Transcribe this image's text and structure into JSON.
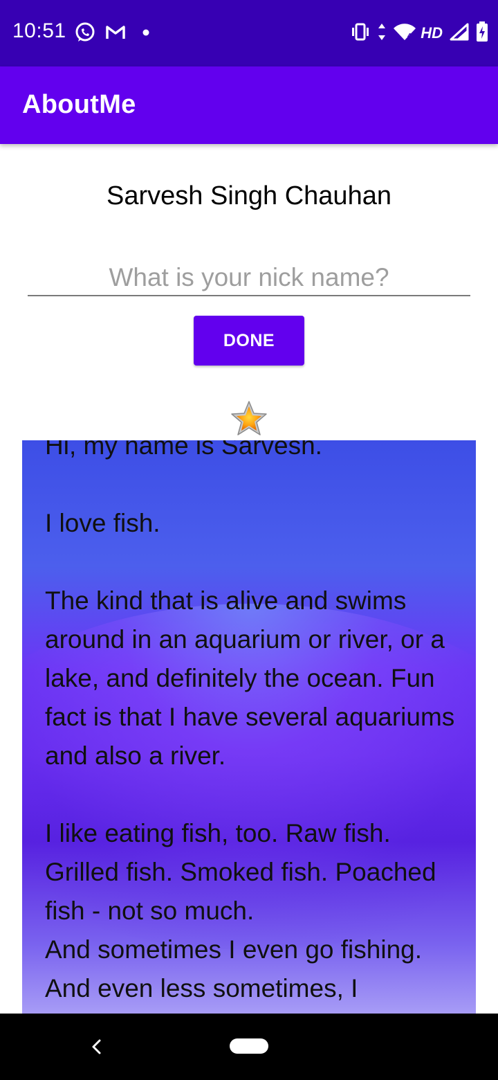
{
  "status_bar": {
    "time": "10:51",
    "left_icons": [
      "whatsapp-icon",
      "gmail-icon",
      "dot-icon"
    ],
    "network_type": "HD",
    "right_icons": [
      "vibrate-icon",
      "data-arrows-icon",
      "wifi-icon",
      "signal-icon",
      "battery-icon"
    ]
  },
  "toolbar": {
    "title": "AboutMe"
  },
  "profile": {
    "name": "Sarvesh Singh Chauhan",
    "nickname_placeholder": "What is your nick name?",
    "nickname_value": "",
    "done_label": "DONE",
    "star_icon": "star-icon"
  },
  "bio": {
    "text": "Hi, my name is Sarvesh.\n\nI love fish.\n\nThe kind that is alive and swims around in an aquarium or river, or a lake, and definitely the ocean. Fun fact is that I have several aquariums and also a river.\n\nI like eating fish, too. Raw fish. Grilled fish. Smoked fish. Poached fish - not so much.\nAnd sometimes I even go fishing.\nAnd even less sometimes, I"
  },
  "nav_bar": {
    "buttons": [
      "back-icon",
      "home-pill"
    ]
  },
  "colors": {
    "status_bar": "#3700B3",
    "toolbar": "#6200EE",
    "button": "#6200EE",
    "nav_bar": "#000000"
  }
}
